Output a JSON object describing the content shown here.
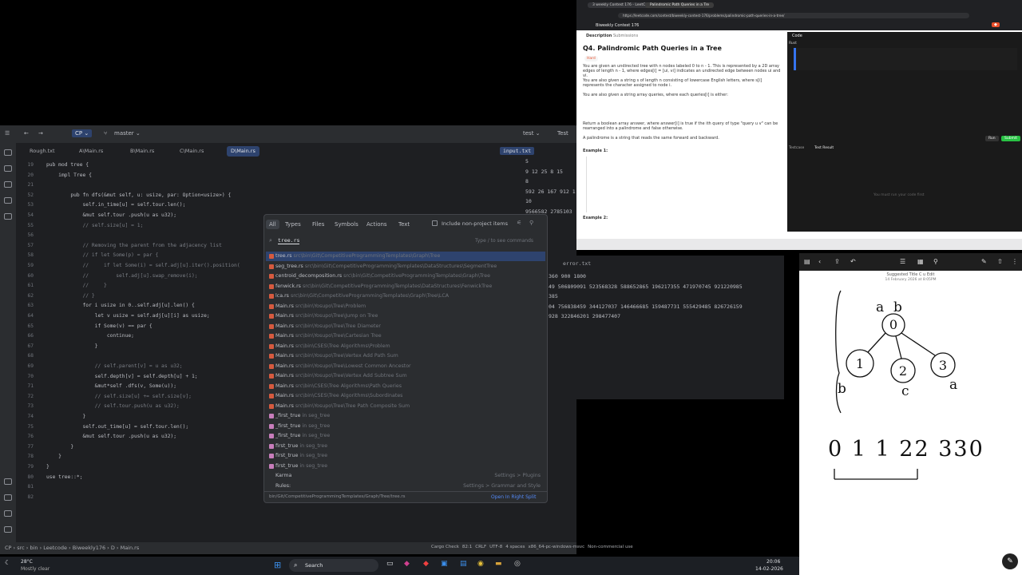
{
  "ide": {
    "project": "CP",
    "branch": "master",
    "run_config": "test",
    "test_label": "Test",
    "tabs": [
      "Rough.txt",
      "A\\Main.rs",
      "B\\Main.rs",
      "C\\Main.rs",
      "D\\Main.rs"
    ],
    "active_tab_index": 4,
    "input_tab": "input.txt",
    "error_tab": "error.txt",
    "code_lines": [
      {
        "n": "19",
        "t": "pub mod tree {"
      },
      {
        "n": "20",
        "t": "    impl Tree {"
      },
      {
        "n": "21",
        "t": ""
      },
      {
        "n": "52",
        "t": "        pub fn dfs(&mut self, u: usize, par: Option<usize>) {"
      },
      {
        "n": "53",
        "t": "            self.in_time[u] = self.tour.len();"
      },
      {
        "n": "54",
        "t": "            &mut self.tour .push(u as u32);"
      },
      {
        "n": "55",
        "t": "            // self.size[u] = 1;"
      },
      {
        "n": "56",
        "t": ""
      },
      {
        "n": "57",
        "t": "            // Removing the parent from the adjacency list"
      },
      {
        "n": "58",
        "t": "            // if let Some(p) = par {"
      },
      {
        "n": "59",
        "t": "            //     if let Some(i) = self.adj[u].iter().position("
      },
      {
        "n": "60",
        "t": "            //         self.adj[u].swap_remove(i);"
      },
      {
        "n": "61",
        "t": "            //     }"
      },
      {
        "n": "62",
        "t": "            // }"
      },
      {
        "n": "63",
        "t": "            for i usize in 0..self.adj[u].len() {"
      },
      {
        "n": "64",
        "t": "                let v usize = self.adj[u][i] as usize;"
      },
      {
        "n": "65",
        "t": "                if Some(v) == par {"
      },
      {
        "n": "66",
        "t": "                    continue;"
      },
      {
        "n": "67",
        "t": "                }"
      },
      {
        "n": "68",
        "t": ""
      },
      {
        "n": "69",
        "t": "                // self.parent[v] = u as u32;"
      },
      {
        "n": "70",
        "t": "                self.depth[v] = self.depth[u] + 1;"
      },
      {
        "n": "71",
        "t": "                &mut*self .dfs(v, Some(u));"
      },
      {
        "n": "72",
        "t": "                // self.size[u] += self.size[v];"
      },
      {
        "n": "73",
        "t": "                // self.tour.push(u as u32);"
      },
      {
        "n": "74",
        "t": "            }"
      },
      {
        "n": "75",
        "t": "            self.out_time[u] = self.tour.len();"
      },
      {
        "n": "76",
        "t": "            &mut self.tour .push(u as u32);"
      },
      {
        "n": "77",
        "t": "        }"
      },
      {
        "n": "78",
        "t": "    }"
      },
      {
        "n": "79",
        "t": "}"
      },
      {
        "n": "80",
        "t": "use tree::*;"
      },
      {
        "n": "81",
        "t": ""
      },
      {
        "n": "82",
        "t": ""
      }
    ],
    "input_lines": [
      "5",
      "9 12 25 8 15",
      "8",
      "592 26 167 912 1",
      "10",
      "9566582 2785103"
    ],
    "output_lines": [
      "360 900 1800",
      "49 506809091 523568328 588652865 196217355 471970745 921220985",
      "385",
      "04 756838459 344127037 146466685 159487731 555429485 826726159",
      "928 322846201 298477407"
    ],
    "status": {
      "breadcrumb": [
        "CP",
        "src",
        "bin",
        "Leetcode",
        "Biweekly176",
        "D",
        "Main.rs"
      ],
      "cargo_check": "Cargo Check",
      "position": "82:1",
      "line_sep": "CRLF",
      "encoding": "UTF-8",
      "indent": "4 spaces",
      "target": "x86_64-pc-windows-msvc",
      "license": "Non-commercial use"
    }
  },
  "popup": {
    "tabs": [
      "All",
      "Types",
      "Files",
      "Symbols",
      "Actions",
      "Text"
    ],
    "include_label": "Include non-project items",
    "query": "tree.rs",
    "hint": "Type / to see commands",
    "results": [
      {
        "name": "tree.rs",
        "path": "src\\bin\\Git\\CompetitiveProgrammingTemplates\\Graph\\Tree"
      },
      {
        "name": "seg_tree.rs",
        "path": "src\\bin\\Git\\CompetitiveProgrammingTemplates\\DataStructures\\SegmentTree"
      },
      {
        "name": "centroid_decomposition.rs",
        "path": "src\\bin\\Git\\CompetitiveProgrammingTemplates\\Graph\\Tree"
      },
      {
        "name": "fenwick.rs",
        "path": "src\\bin\\Git\\CompetitiveProgrammingTemplates\\DataStructures\\FenwickTree"
      },
      {
        "name": "lca.rs",
        "path": "src\\bin\\Git\\CompetitiveProgrammingTemplates\\Graph\\Tree\\LCA"
      },
      {
        "name": "Main.rs",
        "path": "src\\bin\\Yosupo\\Tree\\Problem"
      },
      {
        "name": "Main.rs",
        "path": "src\\bin\\Yosupo\\Tree\\Jump on Tree"
      },
      {
        "name": "Main.rs",
        "path": "src\\bin\\Yosupo\\Tree\\Tree Diameter"
      },
      {
        "name": "Main.rs",
        "path": "src\\bin\\Yosupo\\Tree\\Cartesian Tree"
      },
      {
        "name": "Main.rs",
        "path": "src\\bin\\CSES\\Tree Algorithms\\Problem"
      },
      {
        "name": "Main.rs",
        "path": "src\\bin\\Yosupo\\Tree\\Vertex Add Path Sum"
      },
      {
        "name": "Main.rs",
        "path": "src\\bin\\Yosupo\\Tree\\Lowest Common Ancestor"
      },
      {
        "name": "Main.rs",
        "path": "src\\bin\\Yosupo\\Tree\\Vertex Add Subtree Sum"
      },
      {
        "name": "Main.rs",
        "path": "src\\bin\\CSES\\Tree Algorithms\\Path Queries"
      },
      {
        "name": "Main.rs",
        "path": "src\\bin\\CSES\\Tree Algorithms\\Subordinates"
      },
      {
        "name": "Main.rs",
        "path": "src\\bin\\Yosupo\\Tree\\Tree Path Composite Sum"
      },
      {
        "name": "_first_true",
        "path": "in seg_tree"
      },
      {
        "name": "_first_true",
        "path": "in seg_tree"
      },
      {
        "name": "_first_true",
        "path": "in seg_tree"
      },
      {
        "name": "first_true",
        "path": "in seg_tree"
      },
      {
        "name": "first_true",
        "path": "in seg_tree"
      },
      {
        "name": "first_true",
        "path": "in seg_tree"
      }
    ],
    "extra": [
      {
        "name": "Karma",
        "right": "Settings > Plugins"
      },
      {
        "name": "Rules:",
        "right": "Settings > Grammar and Style"
      }
    ],
    "footer_path": "bin/Git/CompetitiveProgrammingTemplates/Graph/Tree/tree.rs",
    "footer_action": "Open In Right Split"
  },
  "browser": {
    "tab1": "3 weekly Contest 176 - LeetCo",
    "tab2": "Palindromic Path Queries in a Tre",
    "url": "https://leetcode.com/contest/biweekly-contest-176/problems/palindromic-path-queries-in-a-tree/",
    "contest": "Biweekly Contest 176",
    "desc_tab": "Description",
    "sub_tab": "Submissions",
    "title": "Q4. Palindromic Path Queries in a Tree",
    "difficulty": "Hard",
    "code_tab": "Code",
    "lang": "Rust",
    "testcase_tab": "Testcase",
    "test_result_tab": "Test Result",
    "run": "Run",
    "submit": "Submit",
    "para1": "You are given an undirected tree with n nodes labeled 0 to n - 1. This is represented by a 2D array edges of length n - 1, where edges[i] = [ui, vi] indicates an undirected edge between nodes ui and vi.",
    "para2": "You are also given a string s of length n consisting of lowercase English letters, where s[i] represents the character assigned to node i.",
    "para3": "You are also given a string array queries, where each queries[i] is either:",
    "para4": "Return a boolean array answer, where answer[i] is true if the ith query of type \"query u v\" can be rearranged into a palindrome and false otherwise.",
    "para5": "A palindrome is a string that reads the same forward and backward.",
    "example": "Example 1:",
    "example2": "Example 2:",
    "result_hint": "You must run your code first"
  },
  "whiteboard": {
    "title": "Suggested Title C u Edit",
    "date": "14 February 2026 at 8:05PM",
    "sequence": "0 1 1 22 330",
    "root_label": "0",
    "nodes": [
      "1",
      "2",
      "3"
    ],
    "letters": [
      "a",
      "b",
      "b",
      "c",
      "a"
    ]
  },
  "taskbar": {
    "weather_temp": "28°C",
    "weather_desc": "Mostly clear",
    "search": "Search",
    "time": "20:06",
    "date": "14-02-2026"
  }
}
